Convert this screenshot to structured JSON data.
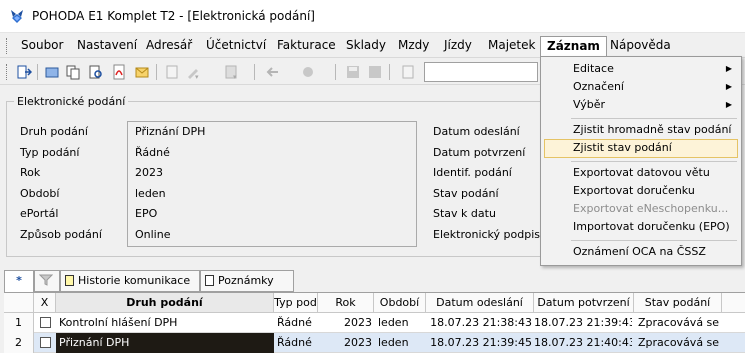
{
  "window": {
    "title": "POHODA E1 Komplet T2 - [Elektronická podání]"
  },
  "menubar": {
    "items": [
      "Soubor",
      "Nastavení",
      "Adresář",
      "Účetnictví",
      "Fakturace",
      "Sklady",
      "Mzdy",
      "Jízdy",
      "Majetek",
      "Záznam",
      "Nápověda"
    ],
    "open_item": "Záznam"
  },
  "dropdown": {
    "items": [
      {
        "label": "Editace",
        "submenu": true
      },
      {
        "label": "Označení",
        "submenu": true
      },
      {
        "label": "Výběr",
        "submenu": true
      },
      {
        "label": "Zjistit hromadně stav podání"
      },
      {
        "label": "Zjistit stav podání",
        "highlighted": true
      },
      {
        "label": "Exportovat datovou větu"
      },
      {
        "label": "Exportovat doručenku"
      },
      {
        "label": "Exportovat eNeschopenku...",
        "disabled": true
      },
      {
        "label": "Importovat doručenku (EPO)"
      },
      {
        "label": "Oznámení OCA na ČSSZ"
      }
    ]
  },
  "form": {
    "group_title": "Elektronické podání",
    "labels": [
      "Druh podání",
      "Typ podání",
      "Rok",
      "Období",
      "ePortál",
      "Způsob podání"
    ],
    "values": [
      "Přiznání DPH",
      "Řádné",
      "2023",
      "leden",
      "EPO",
      "Online"
    ],
    "right_labels": [
      "Datum odeslání",
      "Datum potvrzení",
      "Identif. podání",
      "Stav podání",
      "Stav k datu",
      "Elektronický podpis"
    ]
  },
  "tabs": {
    "star": "*",
    "items": [
      "Historie komunikace",
      "Poznámky"
    ]
  },
  "grid": {
    "headers": [
      "X",
      "Druh podání",
      "Typ pod",
      "Rok",
      "Období",
      "Datum odeslání",
      "Datum potvrzení",
      "Stav podání"
    ],
    "rows": [
      {
        "num": "1",
        "druh": "Kontrolní hlášení DPH",
        "typ": "Řádné",
        "rok": "2023",
        "obdobi": "leden",
        "odeslani": "18.07.23 21:38:43",
        "potvrzeni": "18.07.23 21:39:43",
        "stav": "Zpracovává se"
      },
      {
        "num": "2",
        "druh": "Přiznání DPH",
        "typ": "Řádné",
        "rok": "2023",
        "obdobi": "leden",
        "odeslani": "18.07.23 21:39:45",
        "potvrzeni": "18.07.23 21:40:43",
        "stav": "Zpracovává se"
      }
    ]
  }
}
